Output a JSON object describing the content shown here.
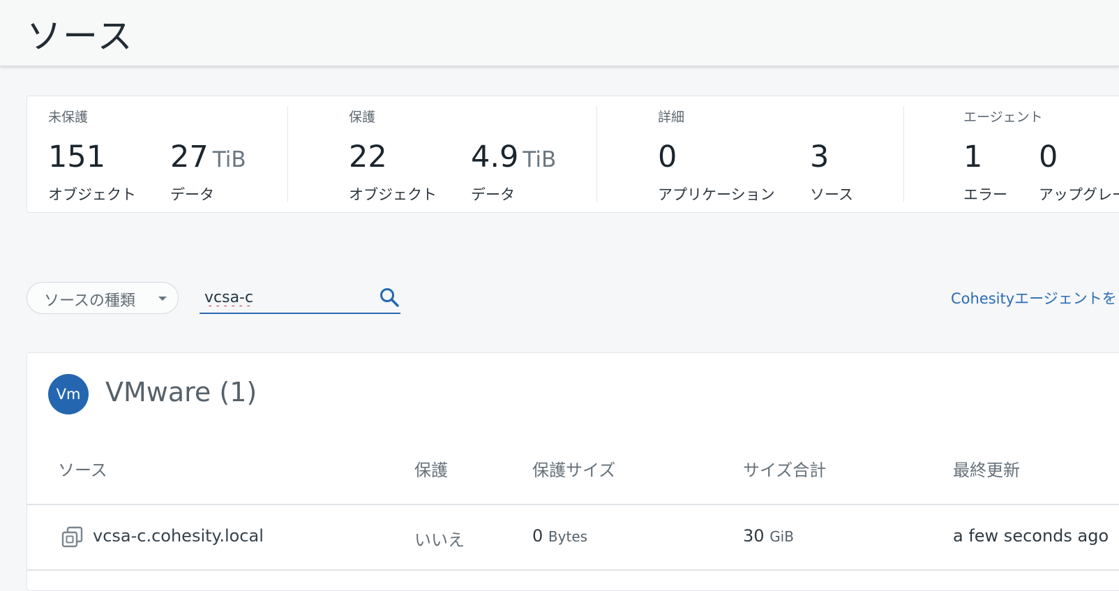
{
  "page": {
    "title": "ソース"
  },
  "stats": [
    {
      "label": "未保護",
      "metrics": [
        {
          "value": "151",
          "unit": "",
          "label": "オブジェクト"
        },
        {
          "value": "27",
          "unit": "TiB",
          "label": "データ"
        }
      ]
    },
    {
      "label": "保護",
      "metrics": [
        {
          "value": "22",
          "unit": "",
          "label": "オブジェクト"
        },
        {
          "value": "4.9",
          "unit": "TiB",
          "label": "データ"
        }
      ]
    },
    {
      "label": "詳細",
      "metrics": [
        {
          "value": "0",
          "unit": "",
          "label": "アプリケーション"
        },
        {
          "value": "3",
          "unit": "",
          "label": "ソース"
        }
      ]
    },
    {
      "label": "エージェント",
      "metrics": [
        {
          "value": "1",
          "unit": "",
          "label": "エラー"
        },
        {
          "value": "0",
          "unit": "",
          "label": "アップグレー"
        }
      ]
    }
  ],
  "filter": {
    "source_type_label": "ソースの種類"
  },
  "search": {
    "value": "vcsa-c",
    "icon": "search-icon"
  },
  "agent_link": {
    "label": "Cohesityエージェントを"
  },
  "results": {
    "group": {
      "avatar": "Vm",
      "title": "VMware (1)"
    },
    "columns": [
      "ソース",
      "保護",
      "保護サイズ",
      "サイズ合計",
      "最終更新"
    ],
    "rows": [
      {
        "icon": "vm-source-icon",
        "source": "vcsa-c.cohesity.local",
        "protected": "いいえ",
        "protected_size": {
          "value": "0",
          "unit": "Bytes"
        },
        "total_size": {
          "value": "30",
          "unit": "GiB"
        },
        "last_updated": "a few seconds ago"
      }
    ]
  },
  "colors": {
    "accent": "#2467b0",
    "link": "#2b6cb4"
  }
}
